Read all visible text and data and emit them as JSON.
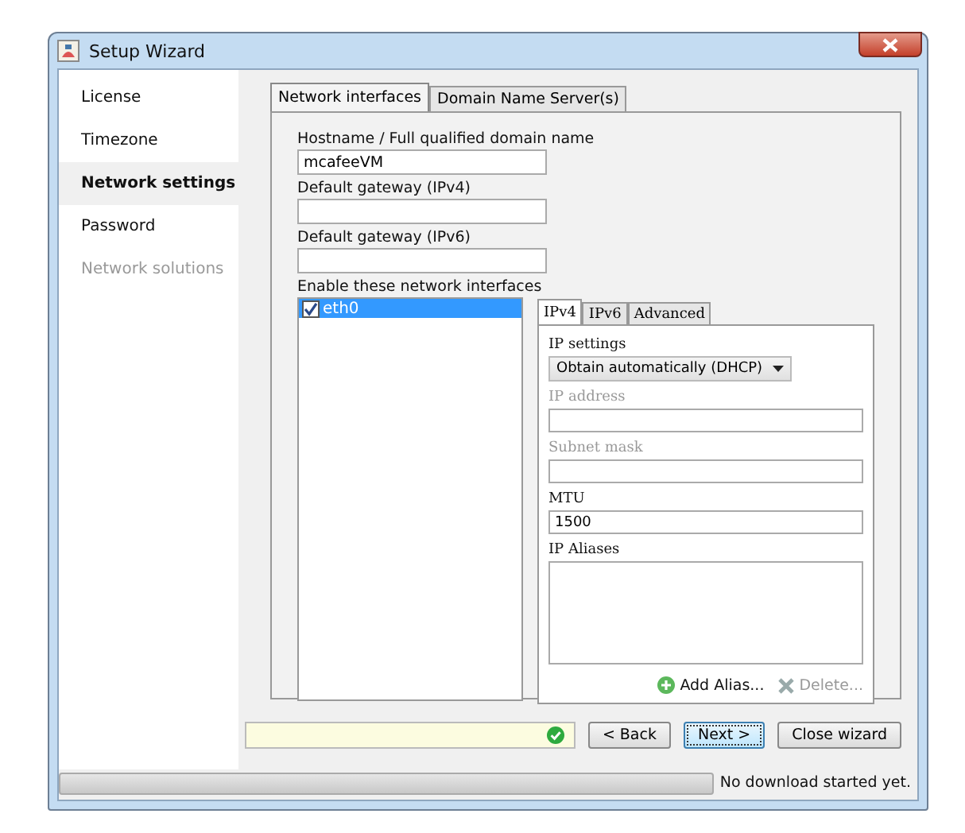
{
  "window": {
    "title": "Setup Wizard"
  },
  "sidebar": {
    "items": [
      {
        "label": "License",
        "selected": false,
        "disabled": false
      },
      {
        "label": "Timezone",
        "selected": false,
        "disabled": false
      },
      {
        "label": "Network settings",
        "selected": true,
        "disabled": false
      },
      {
        "label": "Password",
        "selected": false,
        "disabled": false
      },
      {
        "label": "Network solutions",
        "selected": false,
        "disabled": true
      }
    ]
  },
  "tabs": [
    {
      "label": "Network interfaces",
      "selected": true
    },
    {
      "label": "Domain Name Server(s)",
      "selected": false
    }
  ],
  "fields": [
    {
      "label": "Hostname / Full qualified domain name",
      "value": "mcafeeVM"
    },
    {
      "label": "Default gateway (IPv4)"
    },
    {
      "label": "Default gateway (IPv6)"
    }
  ],
  "interfaces": {
    "label": "Enable these network interfaces",
    "items": [
      {
        "name": "eth0",
        "checked": true,
        "selected": true
      }
    ]
  },
  "inner_tabs": [
    {
      "label": "IPv4",
      "selected": true
    },
    {
      "label": "IPv6",
      "selected": false
    },
    {
      "label": "Advanced",
      "selected": false
    }
  ],
  "ip_settings": {
    "label": "IP settings",
    "value": "Obtain automatically (DHCP)"
  },
  "ip_fields": [
    {
      "label": "IP address",
      "disabled": true
    },
    {
      "label": "Subnet mask",
      "disabled": true
    },
    {
      "label": "MTU",
      "value": "1500",
      "disabled": false
    }
  ],
  "aliases": {
    "label": "IP Aliases"
  },
  "alias_buttons": [
    {
      "label": "Add Alias...",
      "kind": "add",
      "disabled": false
    },
    {
      "label": "Delete...",
      "kind": "delete",
      "disabled": true
    }
  ],
  "buttons": [
    {
      "label": "< Back",
      "focused": false
    },
    {
      "label": "Next >",
      "focused": true
    },
    {
      "label": "Close wizard",
      "focused": false
    }
  ],
  "status_bar": {
    "level": 0,
    "text": "No download started yet."
  }
}
